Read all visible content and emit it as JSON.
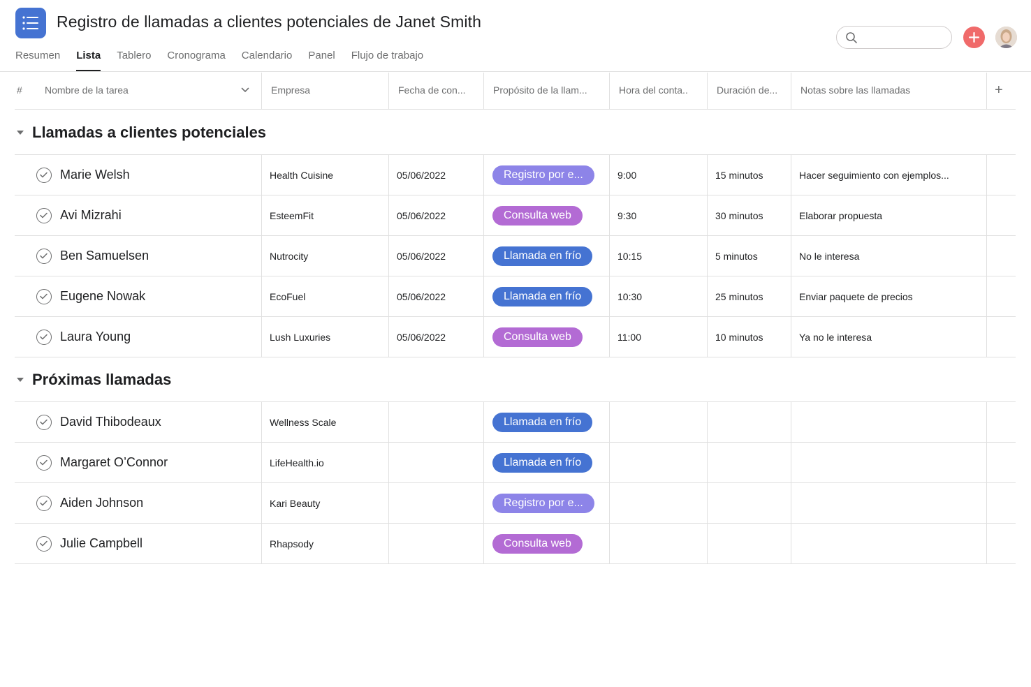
{
  "header": {
    "title": "Registro de llamadas a clientes potenciales de Janet Smith",
    "app_icon": "list-icon",
    "search": {
      "placeholder": ""
    },
    "add_icon": "plus-icon",
    "avatar": "user-avatar"
  },
  "tabs": [
    {
      "label": "Resumen",
      "active": false
    },
    {
      "label": "Lista",
      "active": true
    },
    {
      "label": "Tablero",
      "active": false
    },
    {
      "label": "Cronograma",
      "active": false
    },
    {
      "label": "Calendario",
      "active": false
    },
    {
      "label": "Panel",
      "active": false
    },
    {
      "label": "Flujo de trabajo",
      "active": false
    }
  ],
  "columns": {
    "hash": "#",
    "name": "Nombre de la tarea",
    "company": "Empresa",
    "date": "Fecha de con...",
    "purpose": "Propósito de la llam...",
    "time": "Hora del conta..",
    "duration": "Duración de...",
    "notes": "Notas sobre las llamadas",
    "add": "+"
  },
  "colors": {
    "accent": "#4573d2",
    "add_button": "#f06a6a",
    "pill_registro": "#8d84e8",
    "pill_consulta": "#b36bd4",
    "pill_llamada": "#4573d2"
  },
  "sections": [
    {
      "title": "Llamadas a clientes potenciales",
      "rows": [
        {
          "name": "Marie Welsh",
          "company": "Health Cuisine",
          "date": "05/06/2022",
          "purpose": "Registro por e...",
          "purpose_color": "#8d84e8",
          "time": "9:00",
          "duration": "15 minutos",
          "notes": "Hacer seguimiento con ejemplos..."
        },
        {
          "name": "Avi Mizrahi",
          "company": "EsteemFit",
          "date": "05/06/2022",
          "purpose": "Consulta web",
          "purpose_color": "#b36bd4",
          "time": "9:30",
          "duration": "30 minutos",
          "notes": "Elaborar propuesta"
        },
        {
          "name": "Ben Samuelsen",
          "company": "Nutrocity",
          "date": "05/06/2022",
          "purpose": "Llamada en frío",
          "purpose_color": "#4573d2",
          "time": "10:15",
          "duration": "5 minutos",
          "notes": "No le interesa"
        },
        {
          "name": "Eugene Nowak",
          "company": "EcoFuel",
          "date": "05/06/2022",
          "purpose": "Llamada en frío",
          "purpose_color": "#4573d2",
          "time": "10:30",
          "duration": "25 minutos",
          "notes": "Enviar paquete de precios"
        },
        {
          "name": "Laura Young",
          "company": "Lush Luxuries",
          "date": "05/06/2022",
          "purpose": "Consulta web",
          "purpose_color": "#b36bd4",
          "time": "11:00",
          "duration": "10 minutos",
          "notes": "Ya no le interesa"
        }
      ]
    },
    {
      "title": "Próximas llamadas",
      "rows": [
        {
          "name": "David Thibodeaux",
          "company": "Wellness Scale",
          "date": "",
          "purpose": "Llamada en frío",
          "purpose_color": "#4573d2",
          "time": "",
          "duration": "",
          "notes": ""
        },
        {
          "name": "Margaret O’Connor",
          "company": "LifeHealth.io",
          "date": "",
          "purpose": "Llamada en frío",
          "purpose_color": "#4573d2",
          "time": "",
          "duration": "",
          "notes": ""
        },
        {
          "name": "Aiden Johnson",
          "company": "Kari Beauty",
          "date": "",
          "purpose": "Registro por e...",
          "purpose_color": "#8d84e8",
          "time": "",
          "duration": "",
          "notes": ""
        },
        {
          "name": "Julie Campbell",
          "company": "Rhapsody",
          "date": "",
          "purpose": "Consulta web",
          "purpose_color": "#b36bd4",
          "time": "",
          "duration": "",
          "notes": ""
        }
      ]
    }
  ]
}
